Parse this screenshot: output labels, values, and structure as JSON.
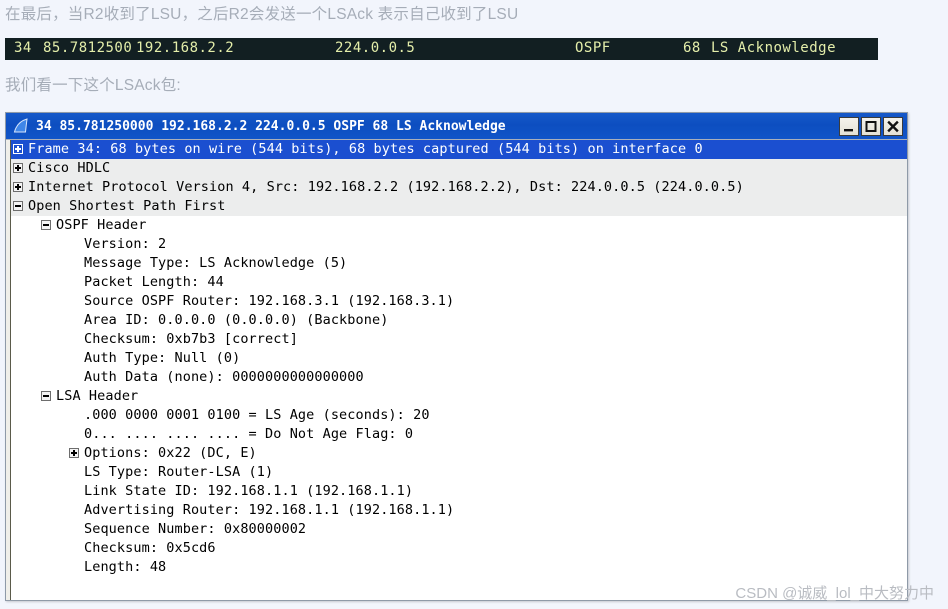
{
  "article": {
    "intro_line": "在最后，当R2收到了LSU，之后R2会发送一个LSAck 表示自己收到了LSU",
    "followup_line": "我们看一下这个LSAck包:"
  },
  "packet_summary": {
    "no": "34",
    "time": "85.7812500",
    "source": "192.168.2.2",
    "destination": "224.0.0.5",
    "protocol": "OSPF",
    "length": "68",
    "info": "LS Acknowledge",
    "bg_color": "#121f22",
    "text_color": "#e4eeaa"
  },
  "window": {
    "title": "34 85.781250000 192.168.2.2 224.0.0.5 OSPF 68 LS Acknowledge",
    "titlebar_color": "#0d4ec0",
    "app_icon": "shark-fin-icon",
    "controls": {
      "minimize": "minimize-icon",
      "maximize": "maximize-icon",
      "close": "close-icon"
    }
  },
  "detail_tree": {
    "selected_index": 0,
    "rows": [
      {
        "level": 0,
        "expander": "plus",
        "label": "Frame 34: 68 bytes on wire (544 bits), 68 bytes captured (544 bits) on interface 0",
        "selected": true,
        "shaded": false
      },
      {
        "level": 0,
        "expander": "plus",
        "label": "Cisco HDLC",
        "selected": false,
        "shaded": true
      },
      {
        "level": 0,
        "expander": "plus",
        "label": "Internet Protocol Version 4, Src: 192.168.2.2 (192.168.2.2), Dst: 224.0.0.5 (224.0.0.5)",
        "selected": false,
        "shaded": true
      },
      {
        "level": 0,
        "expander": "minus",
        "label": "Open Shortest Path First",
        "selected": false,
        "shaded": true
      },
      {
        "level": 1,
        "expander": "minus",
        "label": "OSPF Header",
        "selected": false,
        "shaded": false
      },
      {
        "level": 2,
        "expander": "none",
        "label": "Version: 2",
        "selected": false,
        "shaded": false
      },
      {
        "level": 2,
        "expander": "none",
        "label": "Message Type: LS Acknowledge (5)",
        "selected": false,
        "shaded": false
      },
      {
        "level": 2,
        "expander": "none",
        "label": "Packet Length: 44",
        "selected": false,
        "shaded": false
      },
      {
        "level": 2,
        "expander": "none",
        "label": "Source OSPF Router: 192.168.3.1 (192.168.3.1)",
        "selected": false,
        "shaded": false
      },
      {
        "level": 2,
        "expander": "none",
        "label": "Area ID: 0.0.0.0 (0.0.0.0) (Backbone)",
        "selected": false,
        "shaded": false
      },
      {
        "level": 2,
        "expander": "none",
        "label": "Checksum: 0xb7b3 [correct]",
        "selected": false,
        "shaded": false
      },
      {
        "level": 2,
        "expander": "none",
        "label": "Auth Type: Null (0)",
        "selected": false,
        "shaded": false
      },
      {
        "level": 2,
        "expander": "none",
        "label": "Auth Data (none): 0000000000000000",
        "selected": false,
        "shaded": false
      },
      {
        "level": 1,
        "expander": "minus",
        "label": "LSA Header",
        "selected": false,
        "shaded": false
      },
      {
        "level": 2,
        "expander": "none",
        "label": ".000 0000 0001 0100 = LS Age (seconds): 20",
        "selected": false,
        "shaded": false
      },
      {
        "level": 2,
        "expander": "none",
        "label": "0... .... .... .... = Do Not Age Flag: 0",
        "selected": false,
        "shaded": false
      },
      {
        "level": 2,
        "expander": "plus",
        "label": "Options: 0x22 (DC, E)",
        "selected": false,
        "shaded": false
      },
      {
        "level": 2,
        "expander": "none",
        "label": "LS Type: Router-LSA (1)",
        "selected": false,
        "shaded": false
      },
      {
        "level": 2,
        "expander": "none",
        "label": "Link State ID: 192.168.1.1 (192.168.1.1)",
        "selected": false,
        "shaded": false
      },
      {
        "level": 2,
        "expander": "none",
        "label": "Advertising Router: 192.168.1.1 (192.168.1.1)",
        "selected": false,
        "shaded": false
      },
      {
        "level": 2,
        "expander": "none",
        "label": "Sequence Number: 0x80000002",
        "selected": false,
        "shaded": false
      },
      {
        "level": 2,
        "expander": "none",
        "label": "Checksum: 0x5cd6",
        "selected": false,
        "shaded": false
      },
      {
        "level": 2,
        "expander": "none",
        "label": "Length: 48",
        "selected": false,
        "shaded": false
      }
    ]
  },
  "watermark": {
    "text": "CSDN @诚威_lol_中大努力中"
  }
}
